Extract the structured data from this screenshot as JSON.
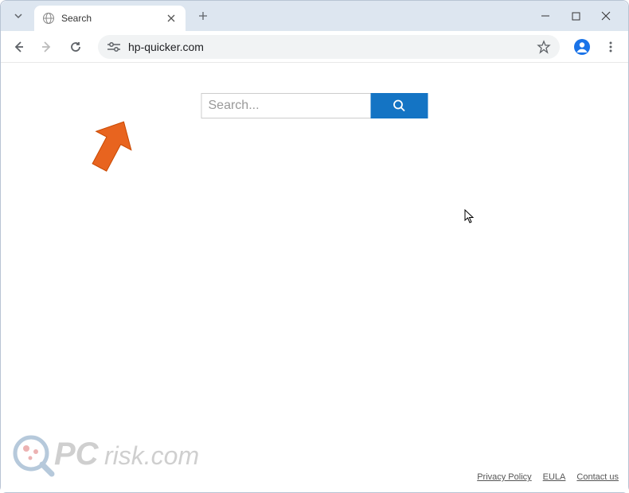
{
  "tab": {
    "title": "Search"
  },
  "address": {
    "url": "hp-quicker.com"
  },
  "search": {
    "placeholder": "Search..."
  },
  "footer": {
    "links": [
      {
        "label": "Privacy Policy"
      },
      {
        "label": "EULA"
      },
      {
        "label": "Contact us"
      }
    ]
  },
  "watermark": {
    "text": "PCrisk.com"
  }
}
